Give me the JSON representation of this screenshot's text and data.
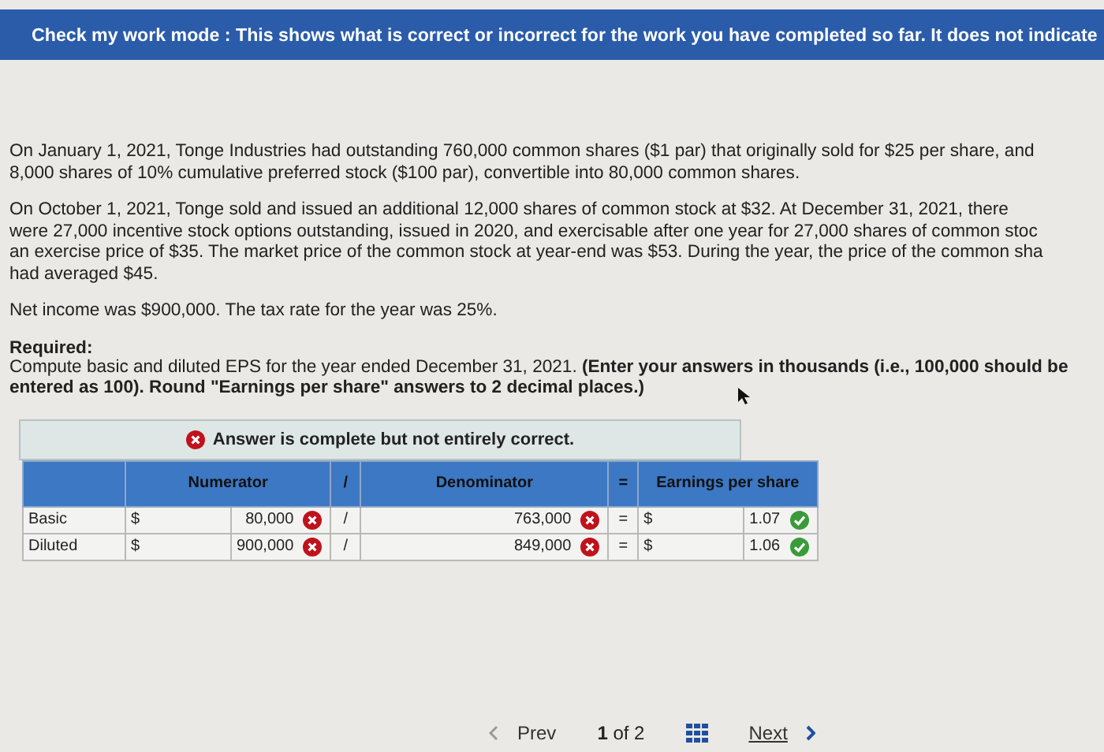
{
  "banner": {
    "text": "Check my work mode : This shows what is correct or incorrect for the work you have completed so far. It does not indicate"
  },
  "paragraphs": [
    {
      "lines": [
        "On January 1, 2021, Tonge Industries had outstanding 760,000 common shares ($1 par) that originally sold for $25 per share, and",
        "8,000 shares of 10% cumulative preferred stock ($100 par), convertible into 80,000 common shares."
      ]
    },
    {
      "lines": [
        "On October 1, 2021, Tonge sold and issued an additional 12,000 shares of common stock at $32. At December 31, 2021, there",
        "were 27,000 incentive stock options outstanding, issued in 2020, and exercisable after one year for 27,000 shares of common stoc",
        "an exercise price of $35. The market price of the common stock at year-end was $53. During the year, the price of the common sha",
        "had averaged $45."
      ]
    },
    {
      "lines": [
        "Net income was $900,000. The tax rate for the year was 25%."
      ]
    }
  ],
  "required": {
    "heading": "Required:",
    "lines": [
      "Compute basic and diluted EPS for the year ended December 31, 2021. **(Enter your answers in thousands (i.e., 100,000 should be**",
      "**entered as 100). Round \"Earnings per share\" answers to 2 decimal places.)**"
    ]
  },
  "result": {
    "correct": false,
    "message": "Answer is complete but not entirely correct."
  },
  "table": {
    "columns": [
      "Numerator",
      "/",
      "Denominator",
      "=",
      "Earnings per share"
    ],
    "rows": [
      {
        "label": "Basic",
        "currency": "$",
        "numerator": "80,000",
        "numerator_correct": false,
        "divide": "/",
        "denominator": "763,000",
        "denominator_correct": false,
        "equals": "=",
        "eps_currency": "$",
        "eps": "1.07",
        "eps_correct": true
      },
      {
        "label": "Diluted",
        "currency": "$",
        "numerator": "900,000",
        "numerator_correct": false,
        "divide": "/",
        "denominator": "849,000",
        "denominator_correct": false,
        "equals": "=",
        "eps_currency": "$",
        "eps": "1.06",
        "eps_correct": true
      }
    ]
  },
  "pager": {
    "prev": "Prev",
    "current": "1",
    "of": "of",
    "total": "2",
    "next": "Next"
  }
}
